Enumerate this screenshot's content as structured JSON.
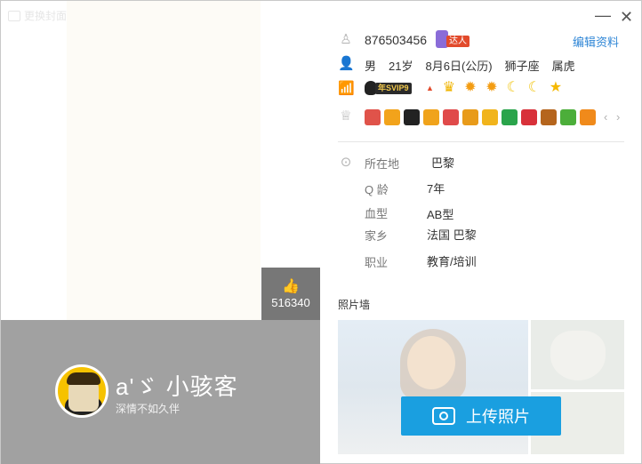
{
  "header": {
    "change_cover_label": "更换封面",
    "minimize_glyph": "—",
    "close_glyph": "✕",
    "edit_label": "编辑资料"
  },
  "profile": {
    "qq_number": "876503456",
    "daren_tag": "达人",
    "gender": "男",
    "age": "21岁",
    "birthday": "8月6日(公历)",
    "zodiac": "狮子座",
    "chinese_zodiac": "属虎",
    "vip_badge": "年SVIP9",
    "likes": "516340",
    "nickname": "a'ゞ  小骇客",
    "signature": "深情不如久伴"
  },
  "level_icons": [
    "crown",
    "sun",
    "sun",
    "moon",
    "moon",
    "star"
  ],
  "services": [
    {
      "name": "heart-service",
      "color": "#e0534a"
    },
    {
      "name": "penguin-service",
      "color": "#f2a31b"
    },
    {
      "name": "qq-service",
      "color": "#222222"
    },
    {
      "name": "music-service",
      "color": "#f0a31b"
    },
    {
      "name": "red-heart-service",
      "color": "#e04a4a"
    },
    {
      "name": "flag-service",
      "color": "#e89b1a"
    },
    {
      "name": "book-service",
      "color": "#f1b41c"
    },
    {
      "name": "green-gem-service",
      "color": "#2aa44b"
    },
    {
      "name": "red-gem-service",
      "color": "#d8313a"
    },
    {
      "name": "gift-service",
      "color": "#b5651d"
    },
    {
      "name": "green-service",
      "color": "#4cae3a"
    },
    {
      "name": "orange-service",
      "color": "#f08a1b"
    }
  ],
  "details": [
    {
      "label": "所在地",
      "value": "巴黎"
    },
    {
      "label": "Q 龄",
      "value": "7年"
    },
    {
      "label": "血型",
      "value": "AB型"
    },
    {
      "label": "家乡",
      "value": "法国 巴黎"
    },
    {
      "label": "职业",
      "value": "教育/培训"
    }
  ],
  "photo_wall": {
    "title": "照片墙",
    "upload_label": "上传照片"
  },
  "colors": {
    "accent": "#1a9fe0",
    "link": "#2f86d6",
    "band": "#a1a1a1"
  }
}
